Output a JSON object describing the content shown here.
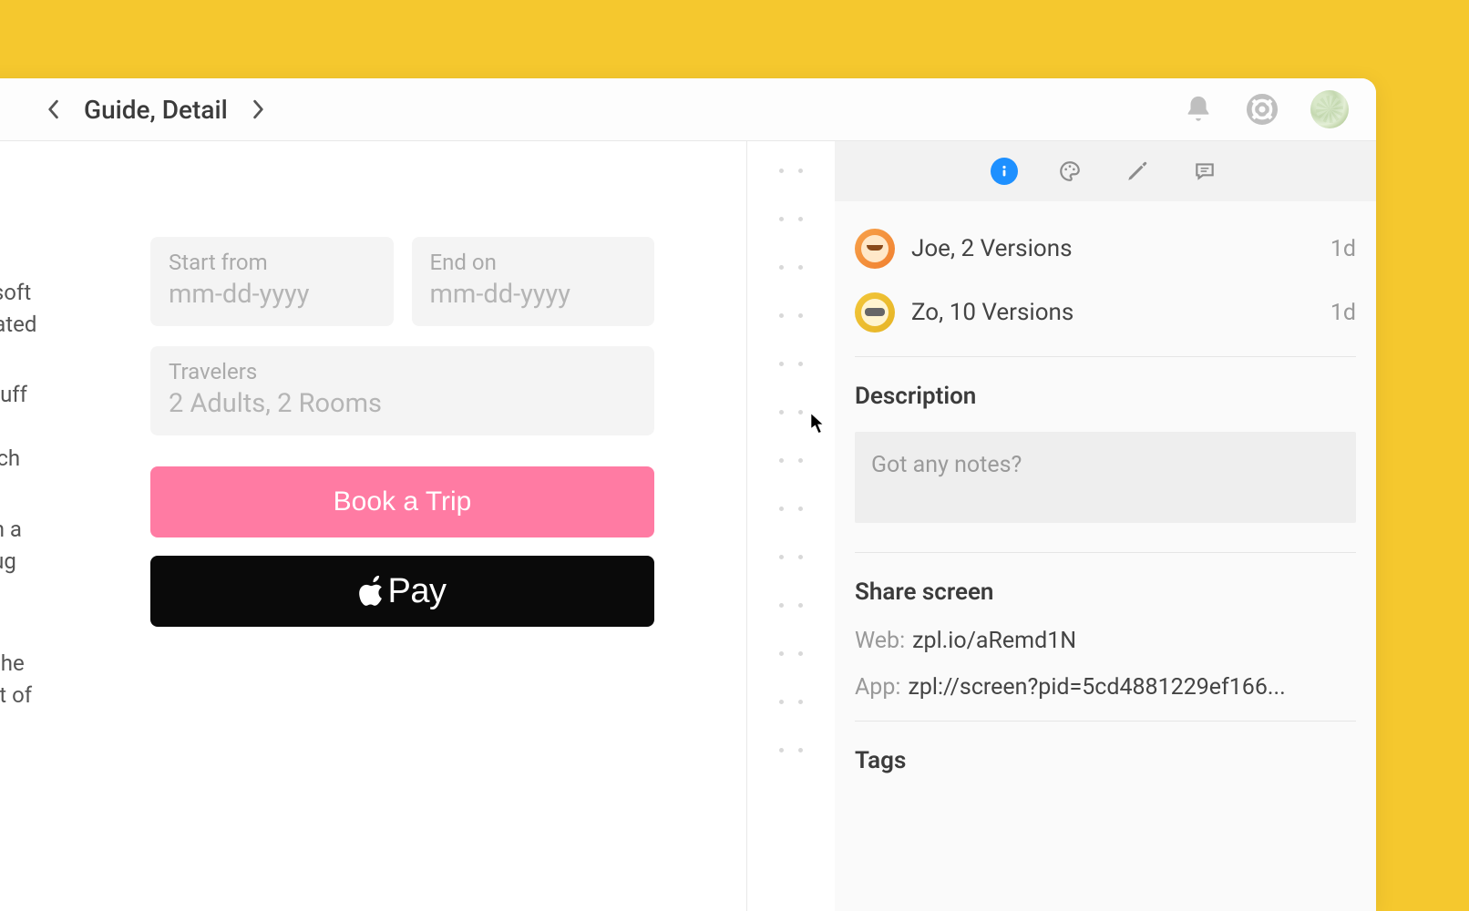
{
  "header": {
    "title": "Guide, Detail"
  },
  "partial_text": {
    "p1": "ans\nhe soft\ncreated",
    "p2": "ed tuff\ns\ntretch",
    "p3": "with a\nll dug\nries",
    "p4": "on the\nhost of\nby"
  },
  "booking": {
    "start_label": "Start from",
    "start_value": "mm-dd-yyyy",
    "end_label": "End on",
    "end_value": "mm-dd-yyyy",
    "trav_label": "Travelers",
    "trav_value": "2 Adults, 2 Rooms",
    "book_btn": "Book a Trip",
    "pay_btn": "Pay"
  },
  "inspector": {
    "versions": [
      {
        "text": "Joe, 2 Versions",
        "time": "1d"
      },
      {
        "text": "Zo, 10 Versions",
        "time": "1d"
      }
    ],
    "desc_title": "Description",
    "desc_placeholder": "Got any notes?",
    "share_title": "Share screen",
    "share_web_label": "Web:",
    "share_web_value": "zpl.io/aRemd1N",
    "share_app_label": "App:",
    "share_app_value": "zpl://screen?pid=5cd4881229ef166...",
    "tags_title": "Tags"
  }
}
